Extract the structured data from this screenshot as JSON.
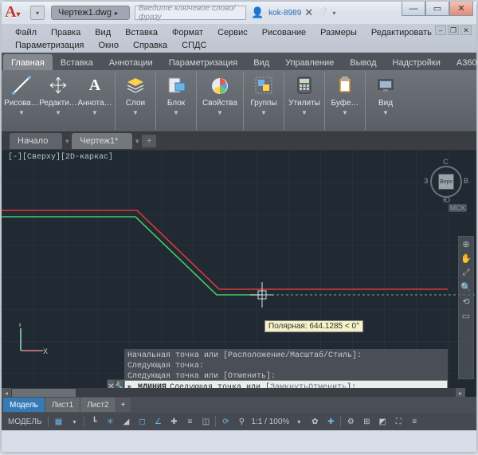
{
  "titlebar": {
    "document_name": "Чертеж1.dwg",
    "search_placeholder": "Введите ключевое слово/фразу",
    "username": "kok-8989"
  },
  "menubar": {
    "items": [
      "Файл",
      "Правка",
      "Вид",
      "Вставка",
      "Формат",
      "Сервис",
      "Рисование",
      "Размеры",
      "Редактировать",
      "Параметризация",
      "Окно",
      "Справка",
      "СПДС"
    ]
  },
  "ribbon": {
    "tabs": [
      "Главная",
      "Вставка",
      "Аннотации",
      "Параметризация",
      "Вид",
      "Управление",
      "Вывод",
      "Надстройки",
      "A360"
    ],
    "active_tab": 0,
    "panels": [
      {
        "buttons": [
          {
            "label": "Рисова…",
            "icon": "line-icon"
          },
          {
            "label": "Редакти…",
            "icon": "move-icon"
          },
          {
            "label": "Аннота…",
            "icon": "text-icon"
          }
        ]
      },
      {
        "buttons": [
          {
            "label": "Слои",
            "icon": "layers-icon"
          }
        ]
      },
      {
        "buttons": [
          {
            "label": "Блок",
            "icon": "block-icon"
          }
        ]
      },
      {
        "buttons": [
          {
            "label": "Свойства",
            "icon": "palette-icon"
          }
        ]
      },
      {
        "buttons": [
          {
            "label": "Группы",
            "icon": "group-icon"
          }
        ]
      },
      {
        "buttons": [
          {
            "label": "Утилиты",
            "icon": "calc-icon"
          }
        ]
      },
      {
        "buttons": [
          {
            "label": "Буфе…",
            "icon": "clipboard-icon"
          }
        ]
      },
      {
        "buttons": [
          {
            "label": "Вид",
            "icon": "view-icon"
          }
        ]
      }
    ]
  },
  "filetabs": {
    "tabs": [
      "Начало",
      "Чертеж1*"
    ],
    "active": 1
  },
  "canvas": {
    "view_label": "[-][Сверху][2D-каркас]",
    "viewcube": {
      "face": "Верх",
      "n": "С",
      "e": "В",
      "s": "Ю",
      "w": "З",
      "cs": "МСК"
    },
    "tooltip": "Полярная: 644.1285 < 0°",
    "ucs_y": "Y",
    "ucs_x": "X"
  },
  "command": {
    "history": [
      "Начальная точка или [Расположение/Масштаб/Стиль]:",
      "Следующая точка:",
      "Следующая точка или [Отменить]:"
    ],
    "prompt_cmd": "МЛИНИЯ",
    "prompt_text": "Следующая точка или [",
    "prompt_opt1": "Замкнуть",
    "prompt_sep": " ",
    "prompt_opt2": "Отменить",
    "prompt_tail": "]:"
  },
  "modeltabs": {
    "tabs": [
      "Модель",
      "Лист1",
      "Лист2"
    ],
    "active": 0
  },
  "statusbar": {
    "model_label": "МОДЕЛЬ",
    "scale": "1:1 / 100%"
  }
}
